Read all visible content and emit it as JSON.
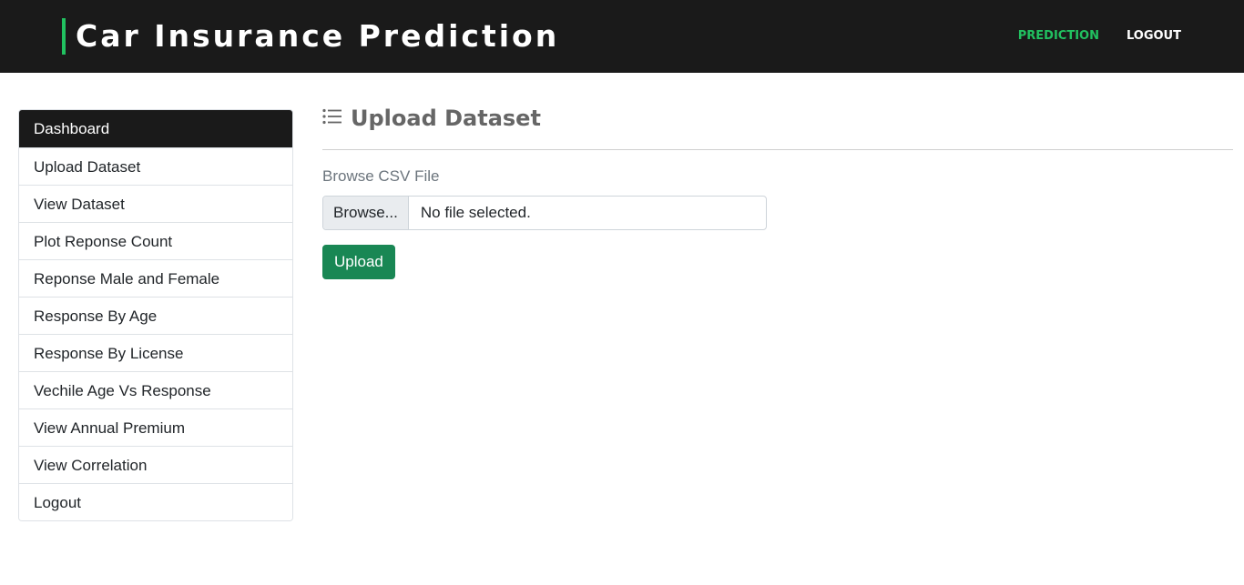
{
  "header": {
    "brand_title": "Car Insurance Prediction",
    "accent_color": "#21c160",
    "nav": [
      {
        "label": "PREDICTION",
        "active": true
      },
      {
        "label": "LOGOUT",
        "active": false
      }
    ]
  },
  "sidebar": {
    "items": [
      {
        "label": "Dashboard",
        "active": true
      },
      {
        "label": "Upload Dataset"
      },
      {
        "label": "View Dataset"
      },
      {
        "label": "Plot Reponse Count"
      },
      {
        "label": "Reponse Male and Female"
      },
      {
        "label": "Response By Age"
      },
      {
        "label": "Response By License"
      },
      {
        "label": "Vechile Age Vs Response"
      },
      {
        "label": "View Annual Premium"
      },
      {
        "label": "View Correlation"
      },
      {
        "label": "Logout"
      }
    ]
  },
  "main": {
    "heading_icon": "list-icon",
    "title": "Upload Dataset",
    "form": {
      "field_label": "Browse CSV File",
      "browse_label": "Browse...",
      "file_status": "No file selected.",
      "submit_label": "Upload",
      "submit_color": "#198754"
    }
  }
}
